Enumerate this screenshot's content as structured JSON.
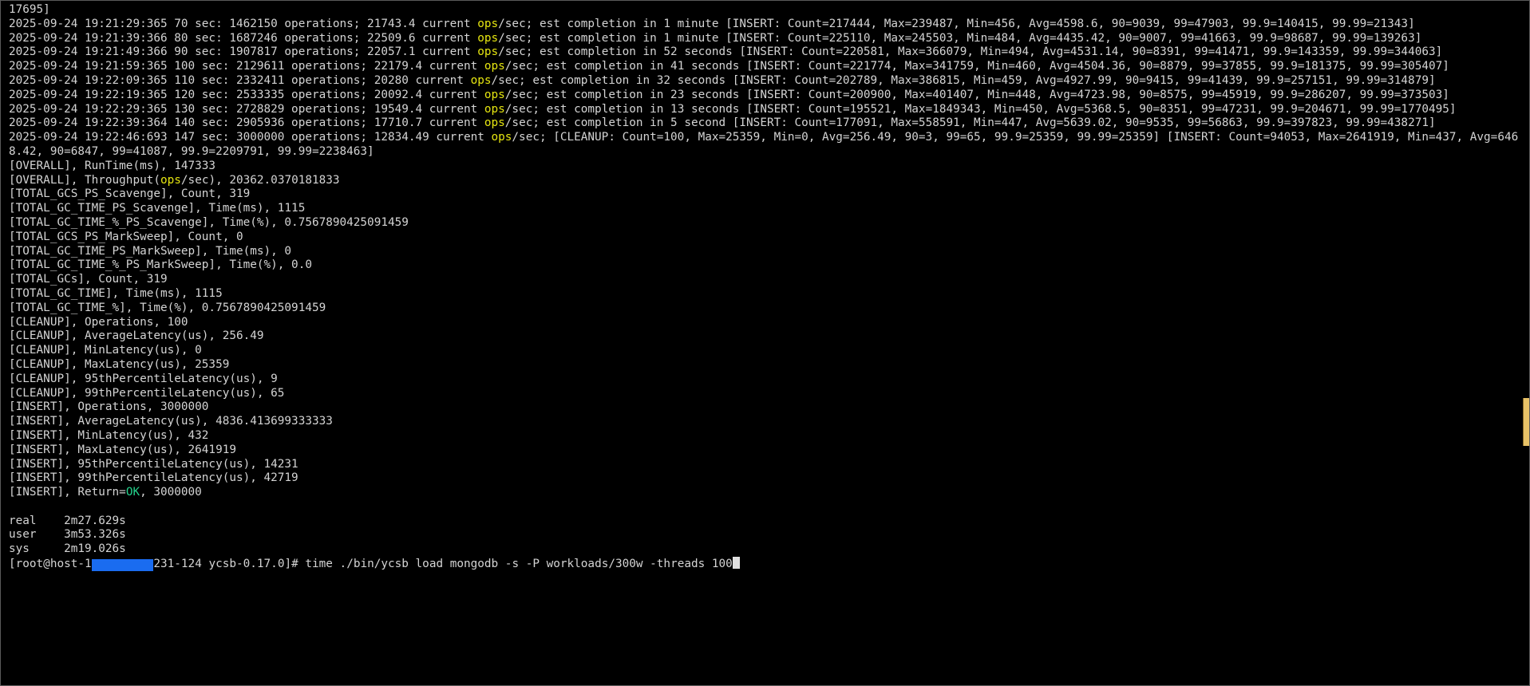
{
  "terminal": {
    "lines": [
      {
        "t": "17695]"
      },
      {
        "t": "2025-09-24 19:21:29:365 70 sec: 1462150 operations; 21743.4 current ",
        "hl": "ops",
        "after": "/sec; est completion in 1 minute [INSERT: Count=217444, Max=239487, Min=456, Avg=4598.6, 90=9039, 99=47903, 99.9=140415, 99.99=21343]"
      },
      {
        "t": "2025-09-24 19:21:39:366 80 sec: 1687246 operations; 22509.6 current ",
        "hl": "ops",
        "after": "/sec; est completion in 1 minute [INSERT: Count=225110, Max=245503, Min=484, Avg=4435.42, 90=9007, 99=41663, 99.9=98687, 99.99=139263]"
      },
      {
        "t": "2025-09-24 19:21:49:366 90 sec: 1907817 operations; 22057.1 current ",
        "hl": "ops",
        "after": "/sec; est completion in 52 seconds [INSERT: Count=220581, Max=366079, Min=494, Avg=4531.14, 90=8391, 99=41471, 99.9=143359, 99.99=344063]"
      },
      {
        "t": "2025-09-24 19:21:59:365 100 sec: 2129611 operations; 22179.4 current ",
        "hl": "ops",
        "after": "/sec; est completion in 41 seconds [INSERT: Count=221774, Max=341759, Min=460, Avg=4504.36, 90=8879, 99=37855, 99.9=181375, 99.99=305407]"
      },
      {
        "t": "2025-09-24 19:22:09:365 110 sec: 2332411 operations; 20280 current ",
        "hl": "ops",
        "after": "/sec; est completion in 32 seconds [INSERT: Count=202789, Max=386815, Min=459, Avg=4927.99, 90=9415, 99=41439, 99.9=257151, 99.99=314879]"
      },
      {
        "t": "2025-09-24 19:22:19:365 120 sec: 2533335 operations; 20092.4 current ",
        "hl": "ops",
        "after": "/sec; est completion in 23 seconds [INSERT: Count=200900, Max=401407, Min=448, Avg=4723.98, 90=8575, 99=45919, 99.9=286207, 99.99=373503]"
      },
      {
        "t": "2025-09-24 19:22:29:365 130 sec: 2728829 operations; 19549.4 current ",
        "hl": "ops",
        "after": "/sec; est completion in 13 seconds [INSERT: Count=195521, Max=1849343, Min=450, Avg=5368.5, 90=8351, 99=47231, 99.9=204671, 99.99=1770495]"
      },
      {
        "t": "2025-09-24 19:22:39:364 140 sec: 2905936 operations; 17710.7 current ",
        "hl": "ops",
        "after": "/sec; est completion in 5 second [INSERT: Count=177091, Max=558591, Min=447, Avg=5639.02, 90=9535, 99=56863, 99.9=397823, 99.99=438271]"
      },
      {
        "t": "2025-09-24 19:22:46:693 147 sec: 3000000 operations; 12834.49 current ",
        "hl": "ops",
        "after": "/sec; [CLEANUP: Count=100, Max=25359, Min=0, Avg=256.49, 90=3, 99=65, 99.9=25359, 99.99=25359] [INSERT: Count=94053, Max=2641919, Min=437, Avg=6468.42, 90=6847, 99=41087, 99.9=2209791, 99.99=2238463]"
      },
      {
        "t": "[OVERALL], RunTime(ms), 147333"
      },
      {
        "t": "[OVERALL], Throughput(",
        "hl": "ops",
        "after": "/sec), 20362.0370181833"
      },
      {
        "t": "[TOTAL_GCS_PS_Scavenge], Count, 319"
      },
      {
        "t": "[TOTAL_GC_TIME_PS_Scavenge], Time(ms), 1115"
      },
      {
        "t": "[TOTAL_GC_TIME_%_PS_Scavenge], Time(%), 0.7567890425091459"
      },
      {
        "t": "[TOTAL_GCS_PS_MarkSweep], Count, 0"
      },
      {
        "t": "[TOTAL_GC_TIME_PS_MarkSweep], Time(ms), 0"
      },
      {
        "t": "[TOTAL_GC_TIME_%_PS_MarkSweep], Time(%), 0.0"
      },
      {
        "t": "[TOTAL_GCs], Count, 319"
      },
      {
        "t": "[TOTAL_GC_TIME], Time(ms), 1115"
      },
      {
        "t": "[TOTAL_GC_TIME_%], Time(%), 0.7567890425091459"
      },
      {
        "t": "[CLEANUP], Operations, 100"
      },
      {
        "t": "[CLEANUP], AverageLatency(us), 256.49"
      },
      {
        "t": "[CLEANUP], MinLatency(us), 0"
      },
      {
        "t": "[CLEANUP], MaxLatency(us), 25359"
      },
      {
        "t": "[CLEANUP], 95thPercentileLatency(us), 9"
      },
      {
        "t": "[CLEANUP], 99thPercentileLatency(us), 65"
      },
      {
        "t": "[INSERT], Operations, 3000000"
      },
      {
        "t": "[INSERT], AverageLatency(us), 4836.413699333333"
      },
      {
        "t": "[INSERT], MinLatency(us), 432"
      },
      {
        "t": "[INSERT], MaxLatency(us), 2641919"
      },
      {
        "t": "[INSERT], 95thPercentileLatency(us), 14231"
      },
      {
        "t": "[INSERT], 99thPercentileLatency(us), 42719"
      },
      {
        "t": "[INSERT], Return=",
        "ok": "OK",
        "after": ", 3000000"
      },
      {
        "t": ""
      },
      {
        "t": "real\t2m27.629s"
      },
      {
        "t": "user\t3m53.326s"
      },
      {
        "t": "sys\t2m19.026s"
      }
    ],
    "prompt": {
      "before": "[root@host-1",
      "redacted": "XXXXXXXXX",
      "after": "231-124 ycsb-0.17.0]# ",
      "command": "time ./bin/ycsb load mongodb -s -P workloads/300w -threads 100"
    }
  },
  "colors": {
    "background": "#000000",
    "text": "#d4d4d4",
    "highlight_yellow": "#e5e510",
    "highlight_green": "#23d18b",
    "redaction": "#1a6cf0",
    "scroll_marker": "#e8c267"
  },
  "icons": {
    "cursor": "block-cursor"
  }
}
